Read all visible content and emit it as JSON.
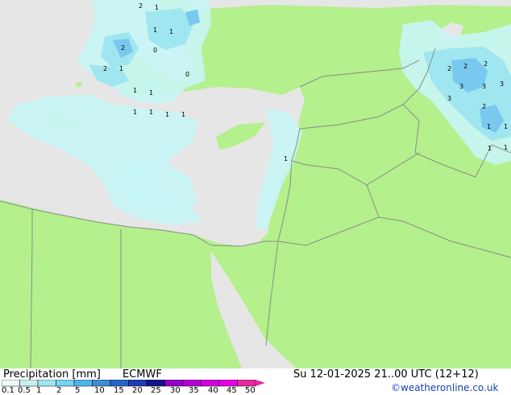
{
  "footer": {
    "title": "Precipitation [mm]",
    "model": "ECMWF",
    "datetime": "Su 12-01-2025 21..00 UTC (12+12)",
    "credit": "©weatheronline.co.uk"
  },
  "legend": {
    "ticks": [
      "0.1",
      "0.5",
      "1",
      "2",
      "5",
      "10",
      "15",
      "20",
      "25",
      "30",
      "35",
      "40",
      "45",
      "50"
    ],
    "colors": [
      "#f0fafa",
      "#c8f0f0",
      "#a0e6f0",
      "#78d2f0",
      "#50b4e6",
      "#3c8cd2",
      "#2864c8",
      "#1e3cb4",
      "#14148c",
      "#9600c8",
      "#b400d2",
      "#d200dc",
      "#e600e6",
      "#e628a0"
    ]
  },
  "map": {
    "colors": {
      "land": "#b4f08c",
      "sea": "#e6e6e6",
      "precip_light": "#c8f5f5",
      "precip_mid": "#a0e6f0",
      "precip_high": "#78c8f0",
      "border": "#8c8c8c"
    },
    "labels": [
      "2",
      "1",
      "1",
      "1",
      "2",
      "1",
      "2",
      "1",
      "1",
      "1",
      "1",
      "0",
      "1",
      "1",
      "1",
      "2",
      "2",
      "2",
      "3",
      "3",
      "3",
      "3",
      "2",
      "1",
      "1",
      "1",
      "1",
      "0"
    ]
  }
}
